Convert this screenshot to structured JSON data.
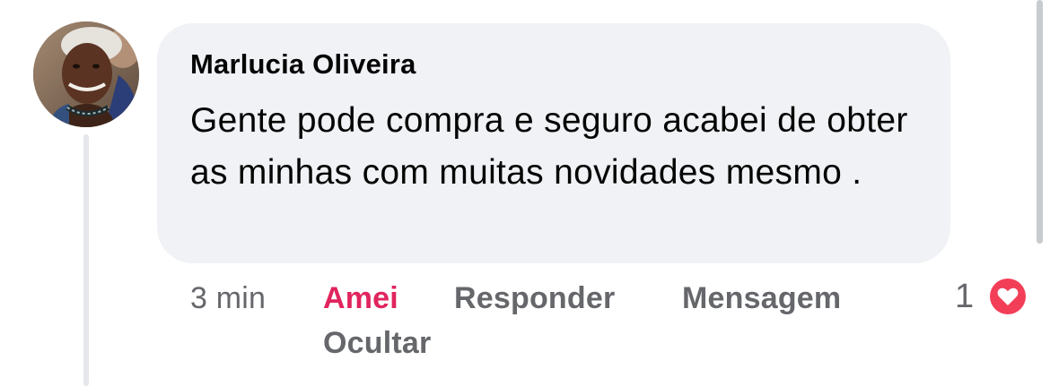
{
  "comment": {
    "author": "Marlucia Oliveira",
    "text": "Gente pode compra e seguro acabei de obter as minhas com muitas novidades mesmo .",
    "time": "3 min",
    "reaction_count": "1",
    "reaction_icon": "heart-icon"
  },
  "actions": {
    "love_label": "Amei",
    "reply_label": "Responder",
    "message_label": "Mensagem",
    "hide_label": "Ocultar"
  },
  "colors": {
    "bubble": "#f0f2f5",
    "secondary_text": "#65676b",
    "love": "#e0245e",
    "heart_badge": "#f33e58"
  }
}
